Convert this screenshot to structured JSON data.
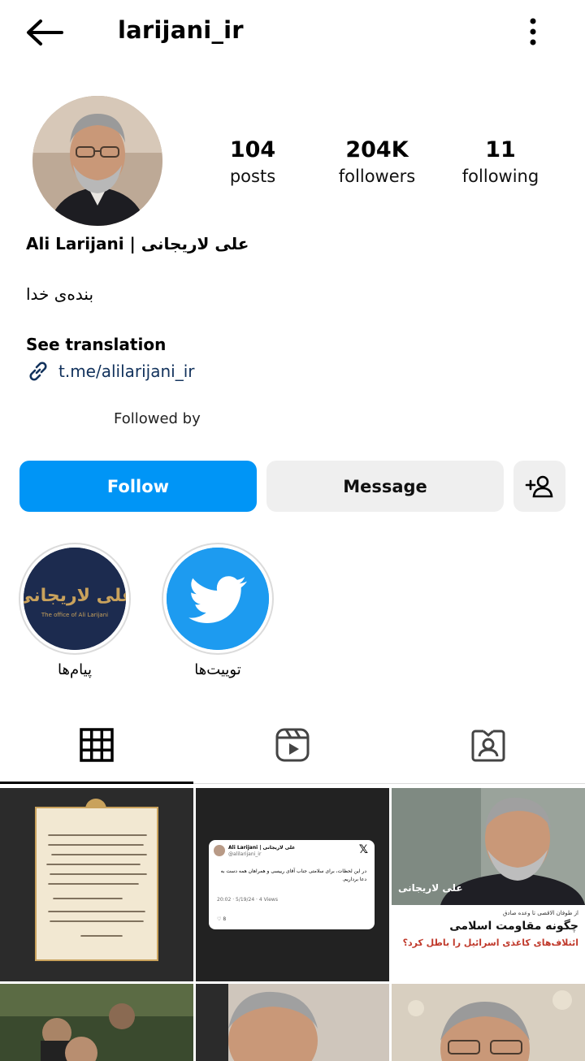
{
  "header": {
    "username": "larijani_ir"
  },
  "stats": [
    {
      "number": "104",
      "label": "posts"
    },
    {
      "number": "204K",
      "label": "followers"
    },
    {
      "number": "11",
      "label": "following"
    }
  ],
  "profile": {
    "full_name": "Ali Larijani | علی لاریجانی",
    "bio": "بنده‌ی خدا",
    "see_translation": "See translation",
    "link": "t.me/alilarijani_ir",
    "followed_by": "Followed by"
  },
  "buttons": {
    "follow": "Follow",
    "message": "Message"
  },
  "highlights": [
    {
      "label": "پیام‌ها",
      "cover_title": "علی لاریجانی",
      "cover_subtitle": "The office of Ali Larijani"
    },
    {
      "label": "توییت‌ها"
    }
  ],
  "posts": {
    "tweet": {
      "author": "Ali Larijani | علی لاریجانی",
      "handle": "@alilarijani_ir",
      "text": "در این لحظات، برای سلامتی جناب آقای رییسی و همراهان همه دست به دعا برداریم.",
      "meta": "20:02 · 5/19/24 · 4 Views",
      "likes": "8"
    },
    "graphic": {
      "kicker": "از طوفان الاقصی تا وعده صادق",
      "headline": "چگونه مقاومت اسلامی",
      "subheadline": "ائتلاف‌های کاغذی اسرائیل را باطل کرد؟",
      "brand": "علی لاریجانی"
    }
  },
  "colors": {
    "accent": "#0095f6",
    "link": "#12325c",
    "twitter": "#1da1f2",
    "highlight_bg": "#1c2b4f",
    "gold": "#c9a25c"
  }
}
